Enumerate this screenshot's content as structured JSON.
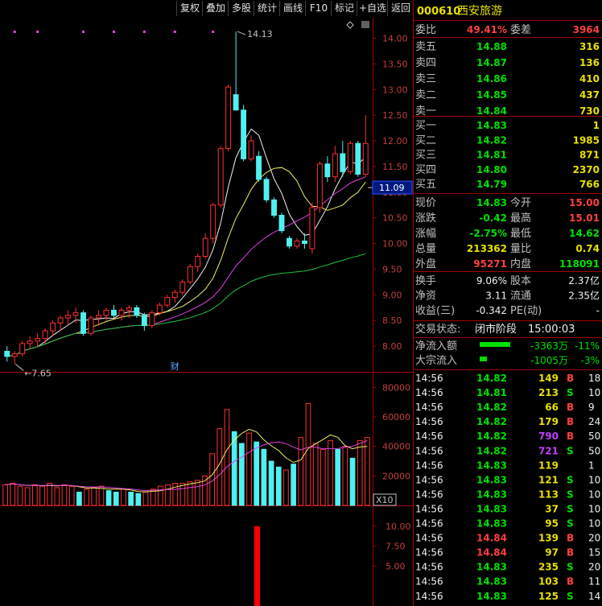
{
  "toolbar": {
    "buttons": [
      "复权",
      "叠加",
      "多股",
      "统计",
      "画线",
      "F10",
      "标记",
      "+自选",
      "返回"
    ]
  },
  "stock": {
    "code": "000610",
    "name": "西安旅游"
  },
  "chart_data": [
    {
      "type": "candlestick",
      "title": "",
      "y_ticks": [
        "14.00",
        "13.50",
        "13.00",
        "12.50",
        "12.00",
        "11.50",
        "11.00",
        "10.50",
        "10.00",
        "9.50",
        "9.00",
        "8.50",
        "8.00"
      ],
      "ylim": [
        7.5,
        14.4
      ],
      "current_price_label": "11.09",
      "high_label": "14.13",
      "low_label": "7.65",
      "event_marker": "财",
      "candles": [
        [
          7.9,
          8.0,
          7.7,
          7.8
        ],
        [
          7.8,
          7.9,
          7.65,
          7.85
        ],
        [
          7.85,
          8.1,
          7.8,
          8.05
        ],
        [
          8.05,
          8.2,
          7.95,
          8.1
        ],
        [
          8.1,
          8.25,
          8.0,
          8.15
        ],
        [
          8.15,
          8.35,
          8.05,
          8.3
        ],
        [
          8.3,
          8.5,
          8.2,
          8.45
        ],
        [
          8.45,
          8.6,
          8.3,
          8.55
        ],
        [
          8.55,
          8.7,
          8.4,
          8.6
        ],
        [
          8.6,
          8.75,
          8.45,
          8.65
        ],
        [
          8.65,
          8.7,
          8.2,
          8.25
        ],
        [
          8.25,
          8.6,
          8.2,
          8.55
        ],
        [
          8.55,
          8.7,
          8.4,
          8.6
        ],
        [
          8.6,
          8.75,
          8.5,
          8.7
        ],
        [
          8.7,
          8.8,
          8.55,
          8.6
        ],
        [
          8.6,
          8.75,
          8.5,
          8.7
        ],
        [
          8.7,
          8.8,
          8.55,
          8.75
        ],
        [
          8.75,
          8.8,
          8.55,
          8.6
        ],
        [
          8.6,
          8.65,
          8.3,
          8.4
        ],
        [
          8.4,
          8.7,
          8.35,
          8.65
        ],
        [
          8.65,
          8.85,
          8.6,
          8.8
        ],
        [
          8.8,
          9.0,
          8.75,
          8.95
        ],
        [
          8.95,
          9.1,
          8.85,
          9.05
        ],
        [
          9.05,
          9.3,
          9.0,
          9.25
        ],
        [
          9.25,
          9.6,
          9.2,
          9.55
        ],
        [
          9.55,
          9.8,
          9.45,
          9.75
        ],
        [
          9.75,
          10.2,
          9.7,
          10.1
        ],
        [
          10.1,
          10.8,
          10.0,
          10.75
        ],
        [
          10.75,
          11.9,
          10.7,
          11.85
        ],
        [
          11.85,
          13.1,
          11.8,
          13.05
        ],
        [
          12.9,
          14.13,
          12.6,
          12.6
        ],
        [
          12.6,
          12.7,
          11.6,
          11.65
        ],
        [
          11.65,
          12.1,
          11.6,
          12.0
        ],
        [
          11.7,
          11.8,
          11.2,
          11.25
        ],
        [
          11.25,
          11.3,
          10.8,
          10.85
        ],
        [
          10.85,
          10.9,
          10.5,
          10.55
        ],
        [
          10.55,
          10.6,
          10.2,
          10.25
        ],
        [
          10.1,
          10.15,
          9.9,
          9.95
        ],
        [
          9.95,
          10.1,
          9.9,
          10.05
        ],
        [
          10.05,
          10.2,
          9.9,
          10.0
        ],
        [
          9.9,
          10.8,
          9.8,
          10.7
        ],
        [
          10.7,
          11.6,
          10.6,
          11.55
        ],
        [
          11.55,
          11.7,
          11.2,
          11.3
        ],
        [
          11.3,
          11.9,
          11.2,
          11.75
        ],
        [
          11.75,
          12.0,
          11.3,
          11.4
        ],
        [
          11.4,
          12.0,
          11.35,
          11.95
        ],
        [
          11.95,
          12.0,
          11.3,
          11.35
        ],
        [
          11.35,
          12.5,
          11.3,
          11.95
        ]
      ]
    },
    {
      "type": "bar",
      "title": "",
      "y_ticks": [
        "80000",
        "60000",
        "40000",
        "20000"
      ],
      "ylim": [
        0,
        90000
      ],
      "unit_label": "X10",
      "values": [
        14000,
        15000,
        13000,
        12000,
        14000,
        13000,
        15000,
        12000,
        14000,
        13000,
        9000,
        11000,
        12000,
        13000,
        10000,
        9000,
        11000,
        9000,
        8000,
        9000,
        11000,
        13000,
        14000,
        15000,
        15000,
        16000,
        17000,
        20000,
        35000,
        52000,
        65000,
        50000,
        42000,
        49000,
        43000,
        38000,
        30000,
        26000,
        24000,
        28000,
        46000,
        69000,
        42000,
        38000,
        44000,
        38000,
        40000,
        32000,
        44000,
        46000
      ],
      "down": [
        false,
        false,
        false,
        false,
        false,
        false,
        false,
        false,
        false,
        false,
        true,
        false,
        false,
        false,
        true,
        true,
        false,
        true,
        true,
        false,
        false,
        false,
        false,
        false,
        false,
        false,
        false,
        false,
        false,
        false,
        false,
        true,
        true,
        false,
        true,
        true,
        true,
        true,
        false,
        true,
        false,
        false,
        false,
        false,
        false,
        true,
        false,
        true,
        false,
        false
      ]
    },
    {
      "type": "bar",
      "title": "",
      "y_ticks": [
        "10.00",
        "7.50",
        "5.00"
      ],
      "ylim": [
        0,
        12.5
      ],
      "values": [
        10.0
      ]
    }
  ],
  "quote": {
    "wei_bi_label": "委比",
    "wei_bi": "49.41%",
    "wei_cha_label": "委差",
    "wei_cha": "3964",
    "sells": [
      {
        "label": "卖五",
        "price": "14.88",
        "vol": "316"
      },
      {
        "label": "卖四",
        "price": "14.87",
        "vol": "136"
      },
      {
        "label": "卖三",
        "price": "14.86",
        "vol": "410"
      },
      {
        "label": "卖二",
        "price": "14.85",
        "vol": "437"
      },
      {
        "label": "卖一",
        "price": "14.84",
        "vol": "730"
      }
    ],
    "buys": [
      {
        "label": "买一",
        "price": "14.83",
        "vol": "1"
      },
      {
        "label": "买二",
        "price": "14.82",
        "vol": "1985"
      },
      {
        "label": "买三",
        "price": "14.81",
        "vol": "871"
      },
      {
        "label": "买四",
        "price": "14.80",
        "vol": "2370"
      },
      {
        "label": "买五",
        "price": "14.79",
        "vol": "766"
      }
    ],
    "stats1": [
      {
        "l1": "现价",
        "v1": "14.83",
        "c1": "#00e000",
        "l2": "今开",
        "v2": "15.00",
        "c2": "#ff4040"
      },
      {
        "l1": "涨跌",
        "v1": "-0.42",
        "c1": "#00e000",
        "l2": "最高",
        "v2": "15.01",
        "c2": "#ff4040"
      },
      {
        "l1": "涨幅",
        "v1": "-2.75%",
        "c1": "#00e000",
        "l2": "最低",
        "v2": "14.62",
        "c2": "#00e000"
      },
      {
        "l1": "总量",
        "v1": "213362",
        "c1": "#e8e000",
        "l2": "量比",
        "v2": "0.74",
        "c2": "#e8e000"
      },
      {
        "l1": "外盘",
        "v1": "95271",
        "c1": "#ff4040",
        "l2": "内盘",
        "v2": "118091",
        "c2": "#00e000"
      }
    ],
    "stats2": [
      {
        "l1": "换手",
        "v1": "9.06%",
        "l2": "股本",
        "v2": "2.37亿"
      },
      {
        "l1": "净资",
        "v1": "3.11",
        "l2": "流通",
        "v2": "2.35亿"
      },
      {
        "l1": "收益(三)",
        "v1": "-0.342",
        "l2": "PE(动)",
        "v2": "-"
      }
    ],
    "trade_status_label": "交易状态:",
    "trade_status": "闭市阶段",
    "trade_time": "15:00:03",
    "flows": [
      {
        "label": "净流入额",
        "value": "-3363万",
        "pct": "-11%",
        "bar": 0.82
      },
      {
        "label": "大宗流入",
        "value": "-1005万",
        "pct": "-3%",
        "bar": 0.2
      }
    ],
    "ticks": [
      {
        "t": "14:56",
        "p": "14.82",
        "v": "149",
        "bs": "B",
        "n": "18"
      },
      {
        "t": "14:56",
        "p": "14.81",
        "v": "213",
        "bs": "S",
        "n": "10"
      },
      {
        "t": "14:56",
        "p": "14.82",
        "v": "66",
        "bs": "B",
        "n": "9"
      },
      {
        "t": "14:56",
        "p": "14.82",
        "v": "179",
        "bs": "B",
        "n": "24"
      },
      {
        "t": "14:56",
        "p": "14.82",
        "v": "790",
        "bs": "B",
        "n": "50"
      },
      {
        "t": "14:56",
        "p": "14.82",
        "v": "721",
        "bs": "S",
        "n": "50"
      },
      {
        "t": "14:56",
        "p": "14.83",
        "v": "119",
        "bs": "",
        "n": "1"
      },
      {
        "t": "14:56",
        "p": "14.83",
        "v": "121",
        "bs": "S",
        "n": "10"
      },
      {
        "t": "14:56",
        "p": "14.83",
        "v": "113",
        "bs": "S",
        "n": "10"
      },
      {
        "t": "14:56",
        "p": "14.83",
        "v": "37",
        "bs": "S",
        "n": "10"
      },
      {
        "t": "14:56",
        "p": "14.83",
        "v": "95",
        "bs": "S",
        "n": "10"
      },
      {
        "t": "14:56",
        "p": "14.84",
        "v": "139",
        "bs": "B",
        "n": "20"
      },
      {
        "t": "14:56",
        "p": "14.84",
        "v": "97",
        "bs": "B",
        "n": "15"
      },
      {
        "t": "14:56",
        "p": "14.83",
        "v": "235",
        "bs": "S",
        "n": "20"
      },
      {
        "t": "14:56",
        "p": "14.83",
        "v": "103",
        "bs": "B",
        "n": "11"
      },
      {
        "t": "14:56",
        "p": "14.83",
        "v": "125",
        "bs": "S",
        "n": "14"
      }
    ]
  }
}
